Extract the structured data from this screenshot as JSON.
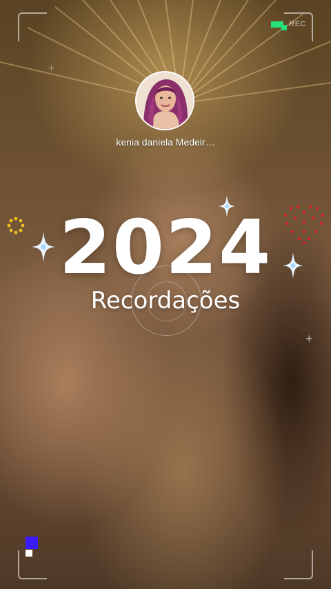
{
  "story": {
    "username": "kenia daniela Medeir…",
    "year": "2024",
    "subtitle": "Recordações",
    "rec_label": "REC"
  },
  "colors": {
    "rec_indicator": "#28e07a",
    "chip_blue": "#3b1cff",
    "sparkle": "#e6f4ff",
    "heart_dots": "#e02020",
    "ring_dots": "#f0c020"
  },
  "icons": {
    "sparkle": "sparkle-icon",
    "heart": "heart-dots-icon",
    "ring": "dot-ring-icon",
    "plus": "plus-icon"
  }
}
